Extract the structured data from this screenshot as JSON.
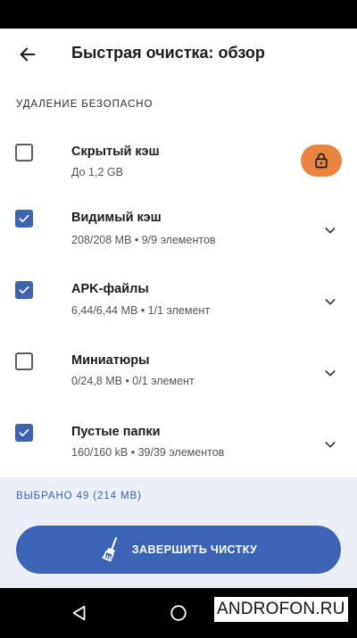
{
  "header": {
    "back_icon": "arrow-left-icon",
    "title": "Быстрая очистка: обзор"
  },
  "section_label": "УДАЛЕНИЕ БЕЗОПАСНО",
  "items": [
    {
      "title": "Скрытый кэш",
      "subtitle": "До 1,2 GB",
      "checked": false,
      "trailing": "lock-icon"
    },
    {
      "title": "Видимый кэш",
      "subtitle": "208/208 MB • 9/9 элементов",
      "checked": true,
      "trailing": "chevron-down-icon"
    },
    {
      "title": "APK-файлы",
      "subtitle": "6,44/6,44 MB • 1/1 элемент",
      "checked": true,
      "trailing": "chevron-down-icon"
    },
    {
      "title": "Миниатюры",
      "subtitle": "0/24,8 MB • 0/1 элемент",
      "checked": false,
      "trailing": "chevron-down-icon"
    },
    {
      "title": "Пустые папки",
      "subtitle": "160/160 kB • 39/39 элементов",
      "checked": true,
      "trailing": "chevron-down-icon"
    }
  ],
  "footer": {
    "selected_text": "ВЫБРАНО 49 (214 MB)",
    "finish_button_label": "ЗАВЕРШИТЬ ЧИСТКУ",
    "finish_button_icon": "broom-icon"
  },
  "navigation": {
    "back": "triangle-back-icon",
    "home": "circle-home-icon",
    "recents": "square-recents-icon"
  },
  "watermark": "ANDROFON.RU",
  "colors": {
    "accent": "#3b64b6",
    "lock_pill": "#e98540",
    "footer_bg": "#ecf0f6"
  }
}
